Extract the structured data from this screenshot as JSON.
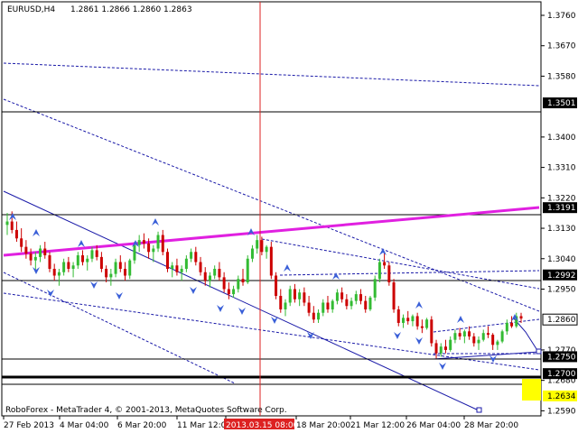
{
  "header": {
    "symbol_timeframe": "EURUSD,H4",
    "ohlc": "1.2861 1.2866 1.2860 1.2863"
  },
  "footer": {
    "copyright": "RoboForex - MetaTrader 4, © 2001-2013, MetaQuotes Software Corp."
  },
  "colors": {
    "background": "#ffffff",
    "bull": "#33bb33",
    "bear": "#cc0000",
    "trend_magenta": "#e020e0",
    "trend_blue": "#1a1aa8",
    "arrow_blue": "#3a5fd8",
    "vline_red": "#dd2222",
    "yellow_box": "#ffff00"
  },
  "chart_data": {
    "type": "candlestick",
    "ylim": [
      1.2575,
      1.38
    ],
    "price_ticks": [
      "1.3760",
      "1.3670",
      "1.3580",
      "1.3400",
      "1.3310",
      "1.3220",
      "1.3130",
      "1.3040",
      "1.2950",
      "1.2770",
      "1.2680",
      "1.2590"
    ],
    "level_labels": [
      {
        "value": 1.3501,
        "text": "1.3501"
      },
      {
        "value": 1.3191,
        "text": "1.3191"
      },
      {
        "value": 1.2992,
        "text": "1.2992"
      },
      {
        "value": 1.286,
        "text": "1.2860"
      },
      {
        "value": 1.275,
        "text": "1.2750"
      },
      {
        "value": 1.27,
        "text": "1.2700"
      },
      {
        "value": 1.2634,
        "text": "1.2634"
      }
    ],
    "time_labels": [
      "27 Feb 2013",
      "4 Mar 04:00",
      "6 Mar 20:00",
      "11 Mar 12:00",
      "2013.03.15 08:00",
      "18 Mar 20:00",
      "21 Mar 12:00",
      "26 Mar 04:00",
      "28 Mar 20:00"
    ],
    "cursor_time": "2013.03.15 08:00",
    "candles": [
      [
        1.314,
        1.3175,
        1.311,
        1.315
      ],
      [
        1.315,
        1.318,
        1.3115,
        1.3125
      ],
      [
        1.3125,
        1.315,
        1.309,
        1.31
      ],
      [
        1.31,
        1.313,
        1.306,
        1.3075
      ],
      [
        1.3075,
        1.3095,
        1.304,
        1.3055
      ],
      [
        1.3055,
        1.307,
        1.302,
        1.3035
      ],
      [
        1.3035,
        1.306,
        1.3,
        1.3045
      ],
      [
        1.3045,
        1.308,
        1.303,
        1.307
      ],
      [
        1.307,
        1.309,
        1.304,
        1.305
      ],
      [
        1.305,
        1.306,
        1.3,
        1.301
      ],
      [
        1.301,
        1.3025,
        1.2975,
        1.299
      ],
      [
        1.299,
        1.301,
        1.296,
        1.3
      ],
      [
        1.3,
        1.304,
        1.299,
        1.303
      ],
      [
        1.303,
        1.3045,
        1.3,
        1.301
      ],
      [
        1.301,
        1.303,
        1.2985,
        1.302
      ],
      [
        1.302,
        1.306,
        1.301,
        1.305
      ],
      [
        1.305,
        1.3065,
        1.302,
        1.303
      ],
      [
        1.303,
        1.305,
        1.3005,
        1.304
      ],
      [
        1.304,
        1.3075,
        1.303,
        1.3065
      ],
      [
        1.3065,
        1.308,
        1.3035,
        1.3045
      ],
      [
        1.3045,
        1.306,
        1.3,
        1.301
      ],
      [
        1.301,
        1.302,
        1.297,
        1.2985
      ],
      [
        1.2985,
        1.301,
        1.296,
        1.2995
      ],
      [
        1.2995,
        1.304,
        1.2985,
        1.303
      ],
      [
        1.303,
        1.305,
        1.3,
        1.301
      ],
      [
        1.301,
        1.303,
        1.2975,
        1.299
      ],
      [
        1.299,
        1.304,
        1.298,
        1.3035
      ],
      [
        1.3035,
        1.309,
        1.3025,
        1.308
      ],
      [
        1.308,
        1.311,
        1.306,
        1.3095
      ],
      [
        1.3095,
        1.3115,
        1.307,
        1.3085
      ],
      [
        1.3085,
        1.31,
        1.304,
        1.306
      ],
      [
        1.306,
        1.308,
        1.303,
        1.307
      ],
      [
        1.307,
        1.312,
        1.306,
        1.311
      ],
      [
        1.311,
        1.3125,
        1.305,
        1.306
      ],
      [
        1.306,
        1.307,
        1.3,
        1.301
      ],
      [
        1.301,
        1.303,
        1.2985,
        1.302
      ],
      [
        1.302,
        1.304,
        1.299,
        1.3
      ],
      [
        1.3,
        1.302,
        1.2975,
        1.301
      ],
      [
        1.301,
        1.305,
        1.3,
        1.304
      ],
      [
        1.304,
        1.307,
        1.303,
        1.306
      ],
      [
        1.306,
        1.3075,
        1.302,
        1.303
      ],
      [
        1.303,
        1.3045,
        1.299,
        1.3
      ],
      [
        1.3,
        1.3015,
        1.296,
        1.2975
      ],
      [
        1.2975,
        1.3,
        1.2955,
        1.299
      ],
      [
        1.299,
        1.302,
        1.298,
        1.301
      ],
      [
        1.301,
        1.303,
        1.2975,
        1.2985
      ],
      [
        1.2985,
        1.3,
        1.294,
        1.295
      ],
      [
        1.295,
        1.297,
        1.292,
        1.2935
      ],
      [
        1.2935,
        1.296,
        1.2925,
        1.295
      ],
      [
        1.295,
        1.299,
        1.294,
        1.298
      ],
      [
        1.298,
        1.301,
        1.296,
        1.297
      ],
      [
        1.297,
        1.305,
        1.2965,
        1.304
      ],
      [
        1.304,
        1.308,
        1.303,
        1.307
      ],
      [
        1.307,
        1.311,
        1.3055,
        1.3095
      ],
      [
        1.3095,
        1.3105,
        1.305,
        1.306
      ],
      [
        1.306,
        1.308,
        1.304,
        1.3075
      ],
      [
        1.3075,
        1.309,
        1.298,
        1.299
      ],
      [
        1.299,
        1.3,
        1.292,
        1.293
      ],
      [
        1.293,
        1.295,
        1.288,
        1.289
      ],
      [
        1.289,
        1.292,
        1.287,
        1.291
      ],
      [
        1.291,
        1.296,
        1.29,
        1.295
      ],
      [
        1.295,
        1.2965,
        1.291,
        1.292
      ],
      [
        1.292,
        1.295,
        1.29,
        1.294
      ],
      [
        1.294,
        1.2955,
        1.29,
        1.291
      ],
      [
        1.291,
        1.293,
        1.287,
        1.288
      ],
      [
        1.288,
        1.29,
        1.285,
        1.286
      ],
      [
        1.286,
        1.289,
        1.285,
        1.288
      ],
      [
        1.288,
        1.292,
        1.287,
        1.291
      ],
      [
        1.291,
        1.293,
        1.288,
        1.289
      ],
      [
        1.289,
        1.292,
        1.288,
        1.2915
      ],
      [
        1.2915,
        1.295,
        1.2905,
        1.294
      ],
      [
        1.294,
        1.2955,
        1.291,
        1.292
      ],
      [
        1.292,
        1.2935,
        1.289,
        1.29
      ],
      [
        1.29,
        1.2925,
        1.289,
        1.2915
      ],
      [
        1.2915,
        1.2945,
        1.2905,
        1.2935
      ],
      [
        1.2935,
        1.295,
        1.2905,
        1.2915
      ],
      [
        1.2915,
        1.293,
        1.288,
        1.289
      ],
      [
        1.289,
        1.293,
        1.2885,
        1.2925
      ],
      [
        1.2925,
        1.299,
        1.2915,
        1.298
      ],
      [
        1.298,
        1.304,
        1.297,
        1.303
      ],
      [
        1.303,
        1.306,
        1.301,
        1.302
      ],
      [
        1.302,
        1.303,
        1.296,
        1.297
      ],
      [
        1.297,
        1.298,
        1.288,
        1.289
      ],
      [
        1.289,
        1.29,
        1.284,
        1.285
      ],
      [
        1.285,
        1.2875,
        1.2835,
        1.2865
      ],
      [
        1.2865,
        1.2885,
        1.2845,
        1.2855
      ],
      [
        1.2855,
        1.2875,
        1.284,
        1.287
      ],
      [
        1.287,
        1.288,
        1.283,
        1.284
      ],
      [
        1.284,
        1.286,
        1.282,
        1.2835
      ],
      [
        1.2835,
        1.2865,
        1.283,
        1.286
      ],
      [
        1.286,
        1.287,
        1.278,
        1.279
      ],
      [
        1.279,
        1.28,
        1.2745,
        1.276
      ],
      [
        1.276,
        1.279,
        1.275,
        1.278
      ],
      [
        1.278,
        1.28,
        1.276,
        1.277
      ],
      [
        1.277,
        1.281,
        1.2765,
        1.28
      ],
      [
        1.28,
        1.283,
        1.279,
        1.282
      ],
      [
        1.282,
        1.2835,
        1.28,
        1.281
      ],
      [
        1.281,
        1.283,
        1.279,
        1.2825
      ],
      [
        1.2825,
        1.284,
        1.28,
        1.281
      ],
      [
        1.281,
        1.282,
        1.278,
        1.279
      ],
      [
        1.279,
        1.281,
        1.277,
        1.28
      ],
      [
        1.28,
        1.283,
        1.2795,
        1.282
      ],
      [
        1.282,
        1.284,
        1.2805,
        1.2815
      ],
      [
        1.2815,
        1.282,
        1.277,
        1.2785
      ],
      [
        1.2785,
        1.28,
        1.277,
        1.2795
      ],
      [
        1.2795,
        1.283,
        1.279,
        1.2825
      ],
      [
        1.2825,
        1.286,
        1.2815,
        1.285
      ],
      [
        1.285,
        1.287,
        1.2835,
        1.284
      ],
      [
        1.284,
        1.288,
        1.2835,
        1.287
      ],
      [
        1.287,
        1.288,
        1.285,
        1.2863
      ]
    ]
  }
}
